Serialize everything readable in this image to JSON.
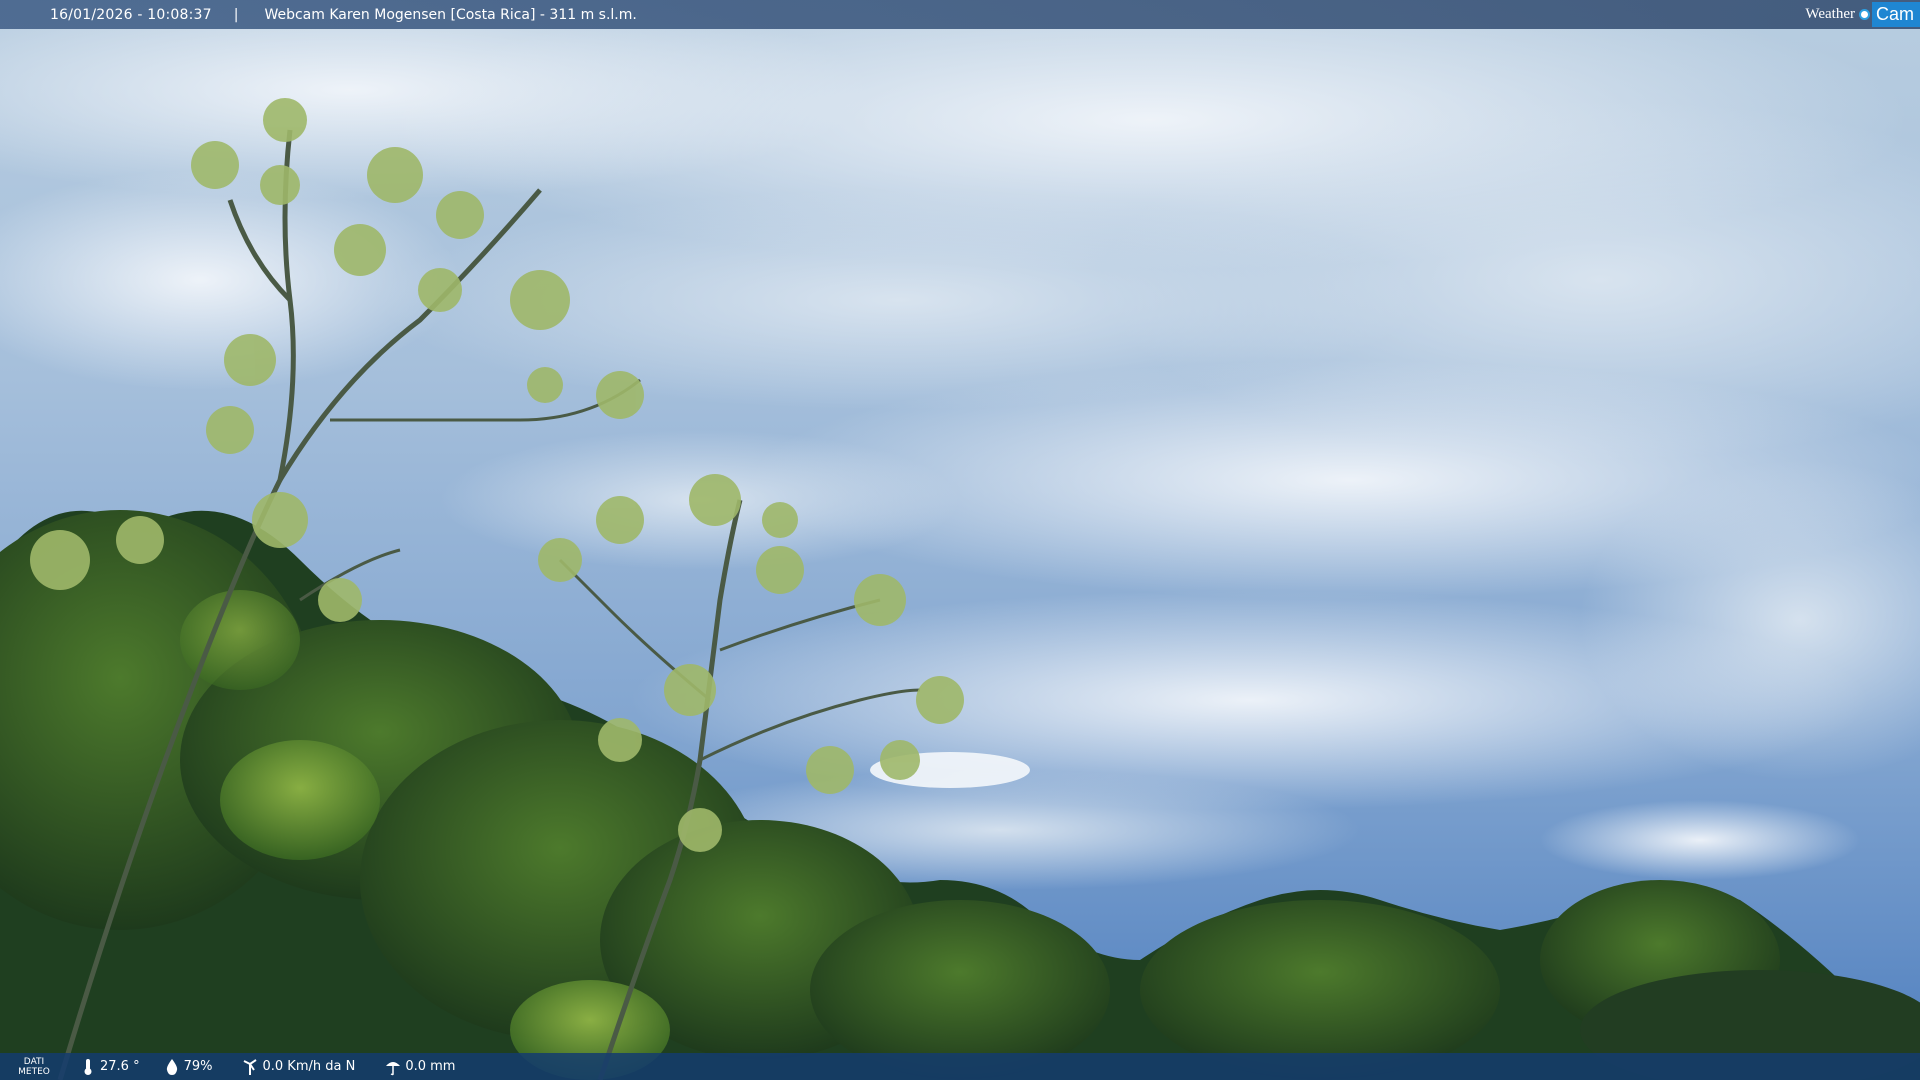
{
  "header": {
    "timestamp": "16/01/2026 - 10:08:37",
    "separator": "|",
    "camera_title": "Webcam Karen Mogensen [Costa Rica]  - 311 m s.l.m."
  },
  "brand": {
    "weather": "Weather",
    "cam": "Cam",
    "accent_color": "#1f86d2"
  },
  "footer": {
    "dati_line1": "DATI",
    "dati_line2": "METEO",
    "temperature": "27.6 °",
    "humidity": "79%",
    "wind": "0.0 Km/h da N",
    "rain": "0.0 mm",
    "icons": [
      "thermometer-icon",
      "humidity-drop-icon",
      "wind-icon",
      "rain-gauge-icon"
    ]
  },
  "colors": {
    "sky_top": "#c9d9e8",
    "sky_blue": "#4f83c1",
    "foliage_dark": "#1d3a1f",
    "foliage_light": "#7ea53f"
  }
}
